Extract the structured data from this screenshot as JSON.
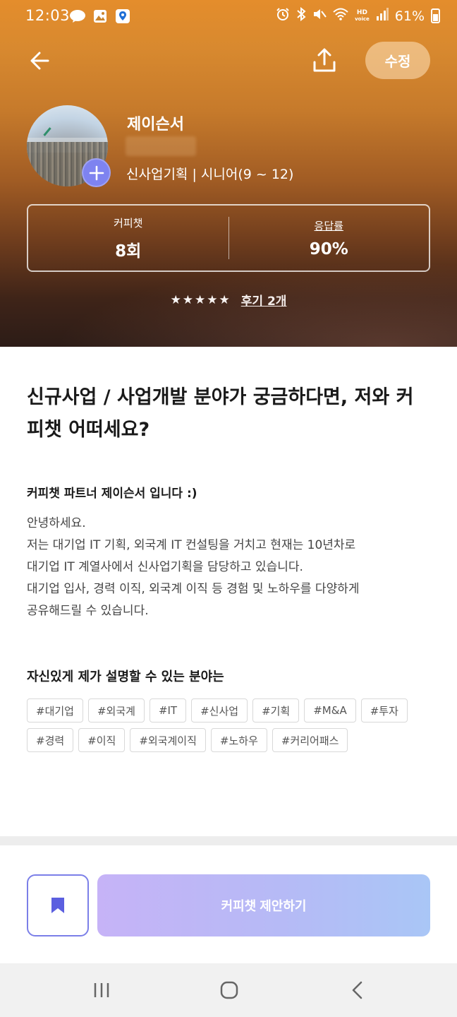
{
  "status_bar": {
    "time": "12:03",
    "battery": "61%",
    "hd_label": "HD",
    "voice_label": "voice",
    "icons": [
      "talk-icon",
      "gallery-icon",
      "location-icon",
      "alarm-icon",
      "bluetooth-icon",
      "mute-icon",
      "wifi-icon",
      "signal-icon",
      "battery-icon"
    ]
  },
  "header": {
    "back_icon": "arrow-left-icon",
    "share_icon": "share-icon",
    "edit_label": "수정"
  },
  "profile": {
    "name": "제이슨서",
    "role": "신사업기획 | 시니어(9 ~ 12)",
    "add_icon": "plus-icon"
  },
  "stats": {
    "coffee_label": "커피챗",
    "coffee_value": "8회",
    "response_label": "응답률",
    "response_value": "90%"
  },
  "rating": {
    "stars": "★★★★★",
    "review_link": "후기 2개"
  },
  "content": {
    "headline": "신규사업 / 사업개발 분야가 궁금하다면, 저와 커피챗 어떠세요?",
    "intro_title": "커피챗 파트너 제이슨서 입니다 :)",
    "intro_body": "안녕하세요.\n저는 대기업 IT 기획, 외국계 IT 컨설팅을 거치고 현재는 10년차로\n대기업 IT 계열사에서 신사업기획을 담당하고 있습니다.\n대기업 입사, 경력 이직, 외국계 이직 등 경험 및 노하우를 다양하게\n공유해드릴 수 있습니다.",
    "expertise_title": "자신있게 제가 설명할 수 있는 분야는",
    "tags": [
      "#대기업",
      "#외국계",
      "#IT",
      "#신사업",
      "#기획",
      "#M&A",
      "#투자",
      "#경력",
      "#이직",
      "#외국계이직",
      "#노하우",
      "#커리어패스"
    ]
  },
  "footer": {
    "bookmark_icon": "bookmark-icon",
    "cta_label": "커피챗 제안하기"
  },
  "nav_bar": {
    "icons": [
      "recent-apps-icon",
      "home-icon",
      "back-icon"
    ]
  },
  "colors": {
    "accent": "#7e83f0",
    "cta_gradient_start": "#c6b3f7",
    "cta_gradient_end": "#a9c6f6"
  }
}
